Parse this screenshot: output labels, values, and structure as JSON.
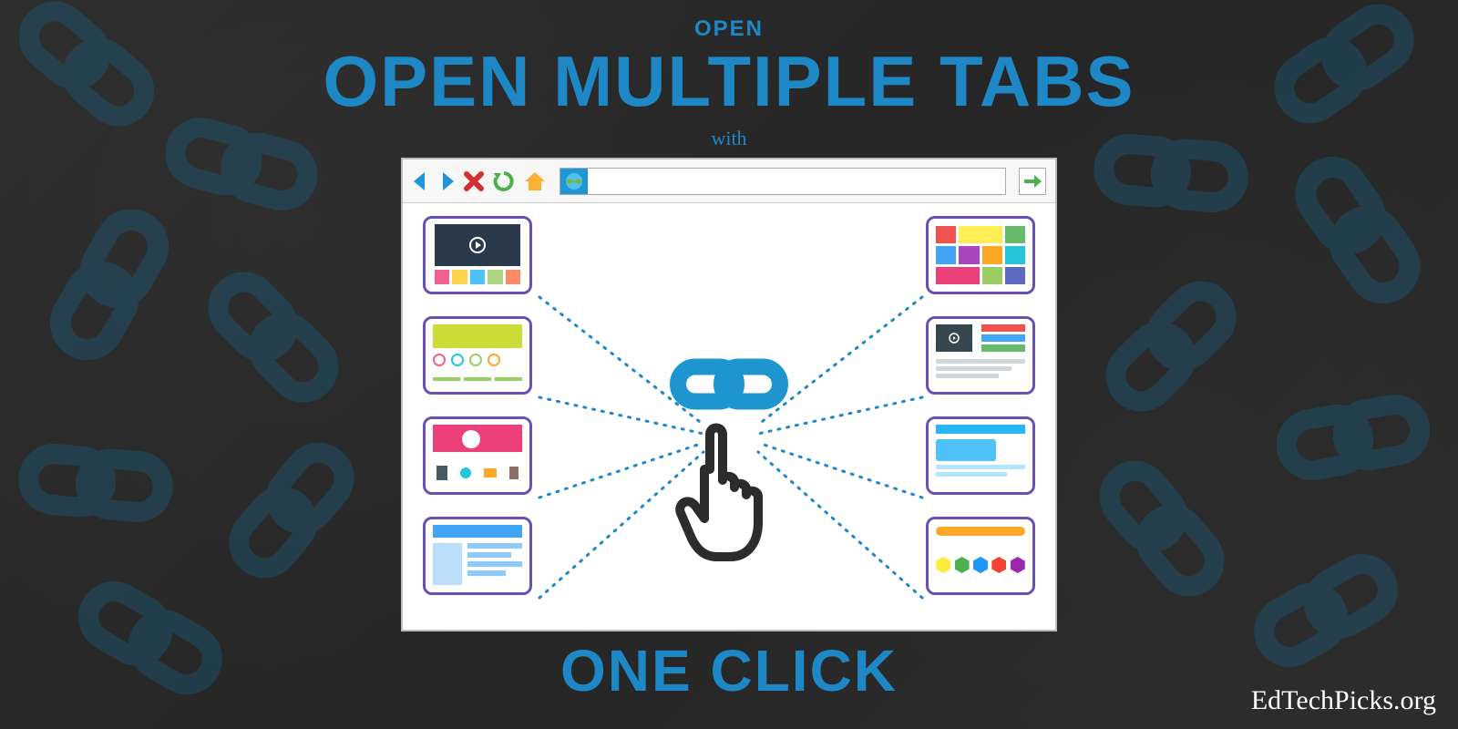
{
  "text": {
    "open_small": "OPEN",
    "main": "OPEN MULTIPLE TABS",
    "with": "with",
    "bottom": "ONE CLICK"
  },
  "attribution": "EdTechPicks.org",
  "colors": {
    "accent": "#1e88c7",
    "thumb_border": "#6a4fb7",
    "bg": "#2a2a2a"
  },
  "icons": {
    "back": "back-arrow",
    "forward": "forward-arrow",
    "close": "close-x",
    "refresh": "refresh-circle",
    "home": "home",
    "globe": "globe",
    "go": "go-arrow",
    "center": "chain-link",
    "cursor": "hand-pointer"
  }
}
